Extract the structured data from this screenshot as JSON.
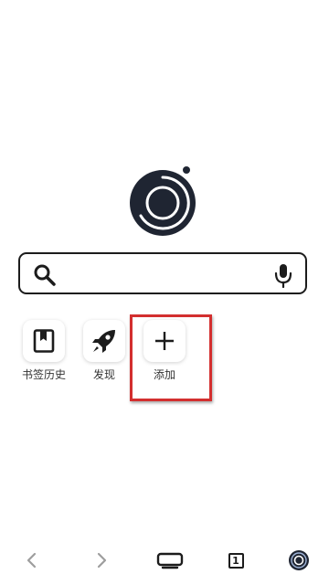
{
  "app": {
    "name": "browser-home"
  },
  "search": {
    "placeholder": "",
    "value": ""
  },
  "shortcuts": [
    {
      "label": "书签历史",
      "icon": "bookmark-icon"
    },
    {
      "label": "发现",
      "icon": "rocket-icon"
    },
    {
      "label": "添加",
      "icon": "plus-icon"
    }
  ],
  "bottom_bar": {
    "tab_count": "1",
    "icons": [
      "back-icon",
      "forward-icon",
      "menu-icon",
      "tabs-icon",
      "home-icon"
    ]
  },
  "colors": {
    "logo_dark": "#1f2532",
    "highlight": "#d32f2f",
    "nav_disabled": "#9e9e9e",
    "text": "#1c1c1c"
  }
}
